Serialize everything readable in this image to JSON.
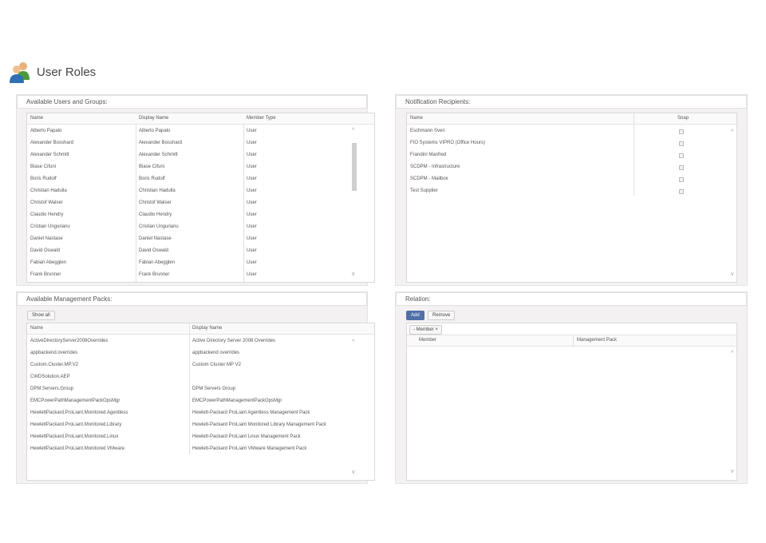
{
  "header": {
    "title": "User Roles",
    "icon": "users-icon"
  },
  "users_panel": {
    "title": "Available Users and Groups:",
    "columns": [
      "Name",
      "Display Name",
      "Member Type"
    ],
    "rows": [
      [
        "Alberto Papalo",
        "Alberto Papalo",
        "User"
      ],
      [
        "Alexander Bosshard",
        "Alexander Bosshard",
        "User"
      ],
      [
        "Alexander Schmitt",
        "Alexander Schmitt",
        "User"
      ],
      [
        "Biase Cifuni",
        "Biase Cifuni",
        "User"
      ],
      [
        "Boris Rudolf",
        "Boris Rudolf",
        "User"
      ],
      [
        "Christian Hadulla",
        "Christian Hadulla",
        "User"
      ],
      [
        "Christof Walser",
        "Christof Walser",
        "User"
      ],
      [
        "Claudio Hendry",
        "Claudio Hendry",
        "User"
      ],
      [
        "Cristian Ungurianu",
        "Cristian Ungurianu",
        "User"
      ],
      [
        "Daniel Nastase",
        "Daniel Nastase",
        "User"
      ],
      [
        "David Oswald",
        "David Oswald",
        "User"
      ],
      [
        "Fabian Abegglen",
        "Fabian Abegglen",
        "User"
      ],
      [
        "Frank Brunner",
        "Frank Brunner",
        "User"
      ]
    ]
  },
  "recipients_panel": {
    "title": "Notification Recipients:",
    "columns": [
      "Name",
      "Snap"
    ],
    "rows": [
      "Eschmann Sven",
      "FIO Systems VIPRO (Office Hours)",
      "Frandini Manfred",
      "SCDPM - Infrastructure",
      "SCDPM - Mailbox",
      "Test Supplier"
    ]
  },
  "packs_panel": {
    "title": "Available Management Packs:",
    "show_all_label": "Show all",
    "columns": [
      "Name",
      "Display Name"
    ],
    "rows": [
      [
        "ActiveDirectoryServer2008Overrides",
        "Active Directory Server 2008 Overrides"
      ],
      [
        "appbackend.overrides",
        "appbackend overrides"
      ],
      [
        "Custom.Cluster.MP.V2",
        "Custom Cluster MP V2"
      ],
      [
        "CWDSolution.AEP",
        ""
      ],
      [
        "DPM.Servers.Group",
        "DPM Servers Group"
      ],
      [
        "EMCPowerPathManagementPackOpsMgr",
        "EMCPowerPathManagementPackOpsMgr"
      ],
      [
        "HewlettPackard.ProLiant.Monitored.Agentless",
        "Hewlett-Packard ProLiant Agentless Management Pack"
      ],
      [
        "HewlettPackard.ProLiant.Monitored.Library",
        "Hewlett-Packard ProLiant Monitored Library Management Pack"
      ],
      [
        "HewlettPackard.ProLiant.Monitored.Linux",
        "Hewlett-Packard ProLiant Linux Management Pack"
      ],
      [
        "HewlettPackard.ProLiant.Monitored.VMware",
        "Hewlett-Packard ProLiant VMware Management Pack"
      ]
    ]
  },
  "relation_panel": {
    "title": "Relation:",
    "add_label": "Add",
    "remove_label": "Remove",
    "tag_label": "Member",
    "tag_close": "×",
    "tag_prefix": "-",
    "columns": [
      "Member",
      "Management Pack"
    ]
  },
  "glyphs": {
    "up": "^",
    "down": "v"
  },
  "colors": {
    "primary_button": "#4f6fa8"
  }
}
